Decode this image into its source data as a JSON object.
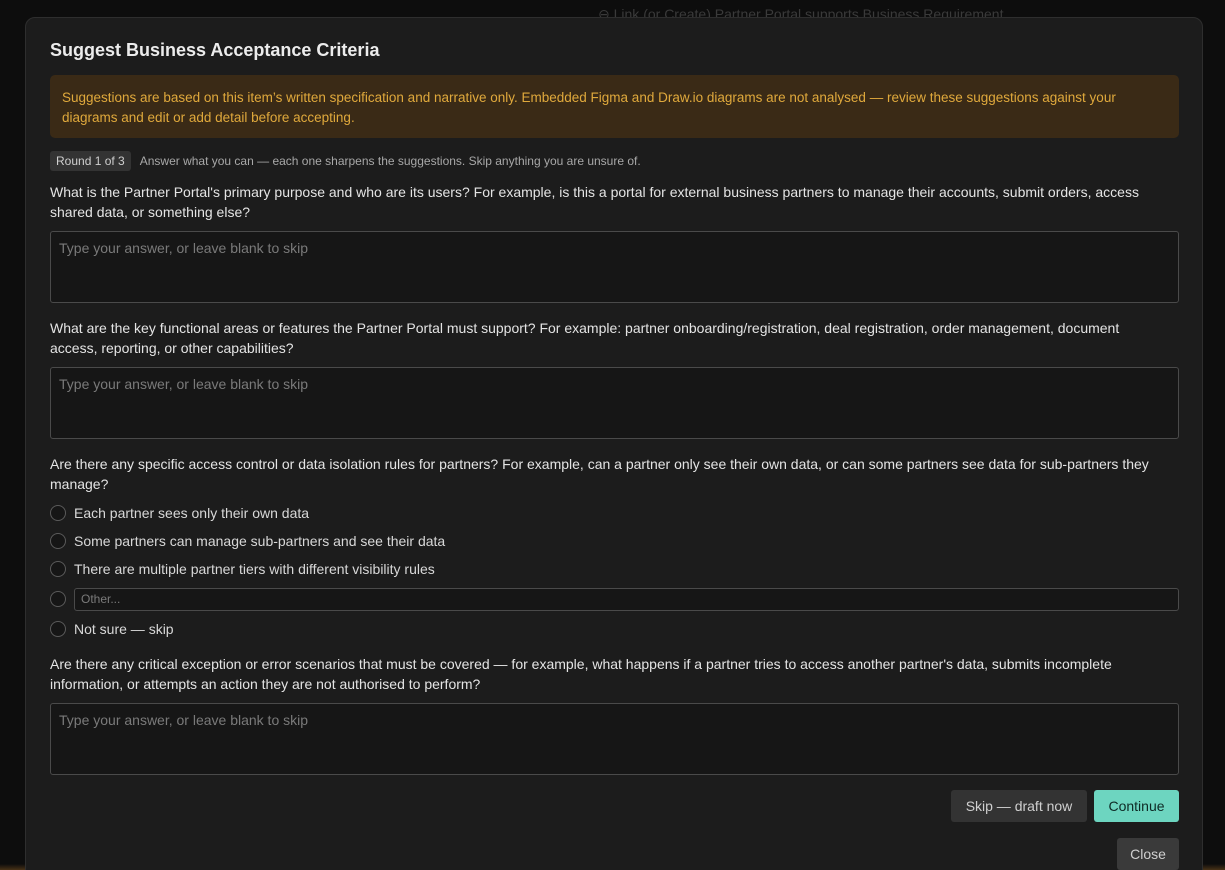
{
  "background": {
    "partial_text": "⊖ Link (or Create) Partner Portal supports Business Requirement"
  },
  "modal": {
    "title": "Suggest Business Acceptance Criteria",
    "warning": "Suggestions are based on this item’s written specification and narrative only. Embedded Figma and Draw.io diagrams are not analysed — review these suggestions against your diagrams and edit or add detail before accepting.",
    "round_badge": "Round 1 of 3",
    "round_hint": "Answer what you can — each one sharpens the suggestions. Skip anything you are unsure of.",
    "questions": [
      {
        "text": "What is the Partner Portal's primary purpose and who are its users? For example, is this a portal for external business partners to manage their accounts, submit orders, access shared data, or something else?",
        "placeholder": "Type your answer, or leave blank to skip",
        "value": ""
      },
      {
        "text": "What are the key functional areas or features the Partner Portal must support? For example: partner onboarding/registration, deal registration, order management, document access, reporting, or other capabilities?",
        "placeholder": "Type your answer, or leave blank to skip",
        "value": ""
      },
      {
        "text": "Are there any specific access control or data isolation rules for partners? For example, can a partner only see their own data, or can some partners see data for sub-partners they manage?",
        "options": [
          "Each partner sees only their own data",
          "Some partners can manage sub-partners and see their data",
          "There are multiple partner tiers with different visibility rules"
        ],
        "other_placeholder": "Other...",
        "skip_option": "Not sure — skip"
      },
      {
        "text": "Are there any critical exception or error scenarios that must be covered — for example, what happens if a partner tries to access another partner's data, submits incomplete information, or attempts an action they are not authorised to perform?",
        "placeholder": "Type your answer, or leave blank to skip",
        "value": ""
      }
    ],
    "buttons": {
      "skip": "Skip — draft now",
      "continue": "Continue",
      "close": "Close"
    }
  },
  "colors": {
    "accent": "#6dd5c0",
    "warning_text": "#e0a93c",
    "warning_bg": "#3a2a16"
  }
}
